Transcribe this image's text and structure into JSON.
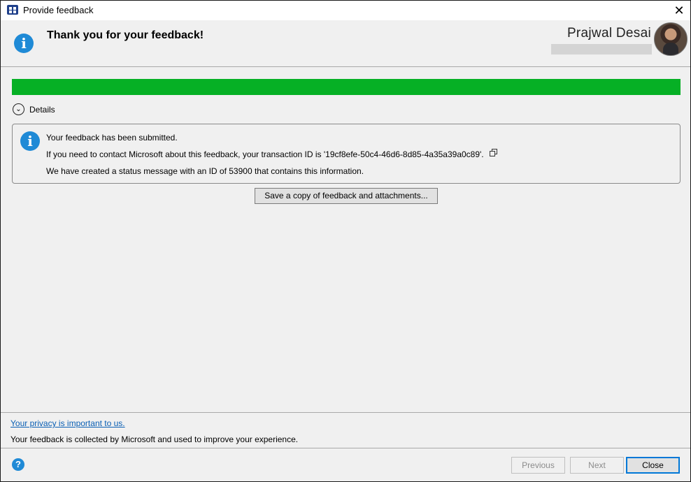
{
  "window": {
    "title": "Provide feedback",
    "close_glyph": "✕"
  },
  "header": {
    "title": "Thank you for your feedback!",
    "info_glyph": "i",
    "user_name": "Prajwal Desai"
  },
  "progress": {
    "percent": 100,
    "color": "#06b025"
  },
  "details": {
    "toggle_glyph": "⌄",
    "label": "Details"
  },
  "message": {
    "info_glyph": "i",
    "line1": "Your feedback has been submitted.",
    "line2": "If you need to contact Microsoft about this feedback, your transaction ID is '19cf8efe-50c4-46d6-8d85-4a35a39a0c89'.",
    "line3": "We have created a status message with an ID of 53900 that contains this information."
  },
  "save_button_label": "Save a copy of feedback and attachments...",
  "footer": {
    "privacy_link": "Your privacy is important to us.",
    "collected_text": "Your feedback is collected by Microsoft and used to improve your experience."
  },
  "buttons": {
    "help_glyph": "?",
    "previous": "Previous",
    "next": "Next",
    "close": "Close"
  },
  "colors": {
    "accent": "#1f8ad6",
    "link": "#0a5fb4",
    "focus_border": "#0078d7"
  }
}
